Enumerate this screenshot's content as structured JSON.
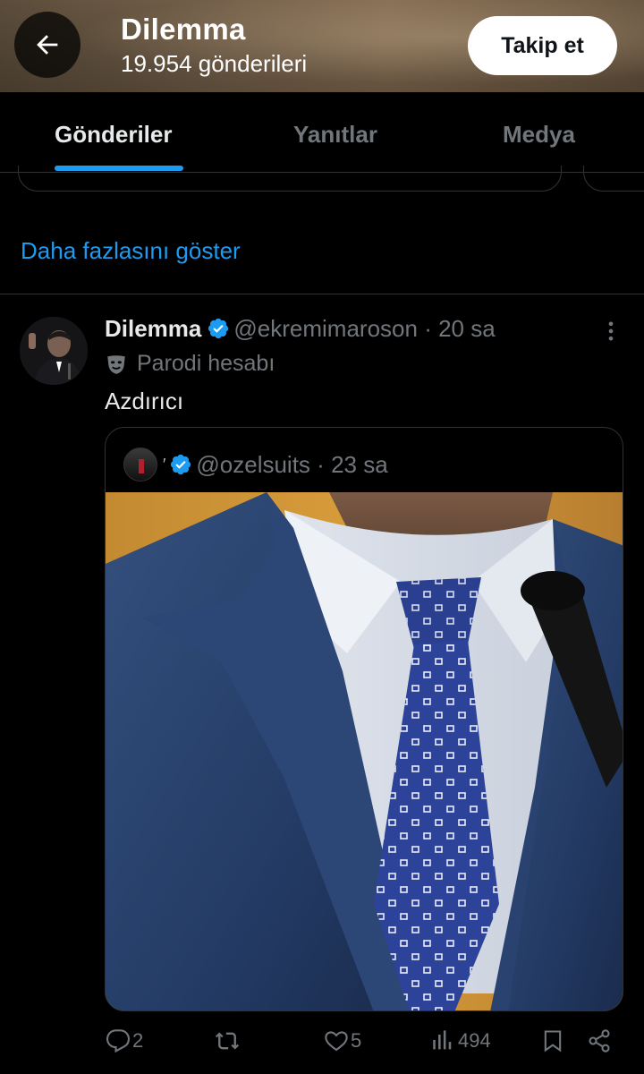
{
  "header": {
    "title": "Dilemma",
    "post_count": "19.954 gönderileri",
    "follow_label": "Takip et"
  },
  "tabs": [
    {
      "label": "Gönderiler",
      "active": true
    },
    {
      "label": "Yanıtlar",
      "active": false
    },
    {
      "label": "Medya",
      "active": false
    }
  ],
  "show_more": "Daha fazlasını göster",
  "post": {
    "name": "Dilemma",
    "handle": "@ekremimaroson",
    "separator": "·",
    "time": "20 sa",
    "badge": "Parodi hesabı",
    "text": "Azdırıcı",
    "quote": {
      "handle": "@ozelsuits",
      "separator": "·",
      "time": "23 sa"
    },
    "actions": {
      "replies": "2",
      "likes": "5",
      "views": "494"
    }
  },
  "colors": {
    "accent": "#1d9bf0",
    "background": "#000000",
    "muted": "#71767b"
  },
  "icons": [
    "back-arrow-icon",
    "verified-icon",
    "more-icon",
    "parody-mask-icon",
    "reply-icon",
    "repost-icon",
    "like-icon",
    "views-icon",
    "bookmark-icon",
    "share-icon"
  ]
}
